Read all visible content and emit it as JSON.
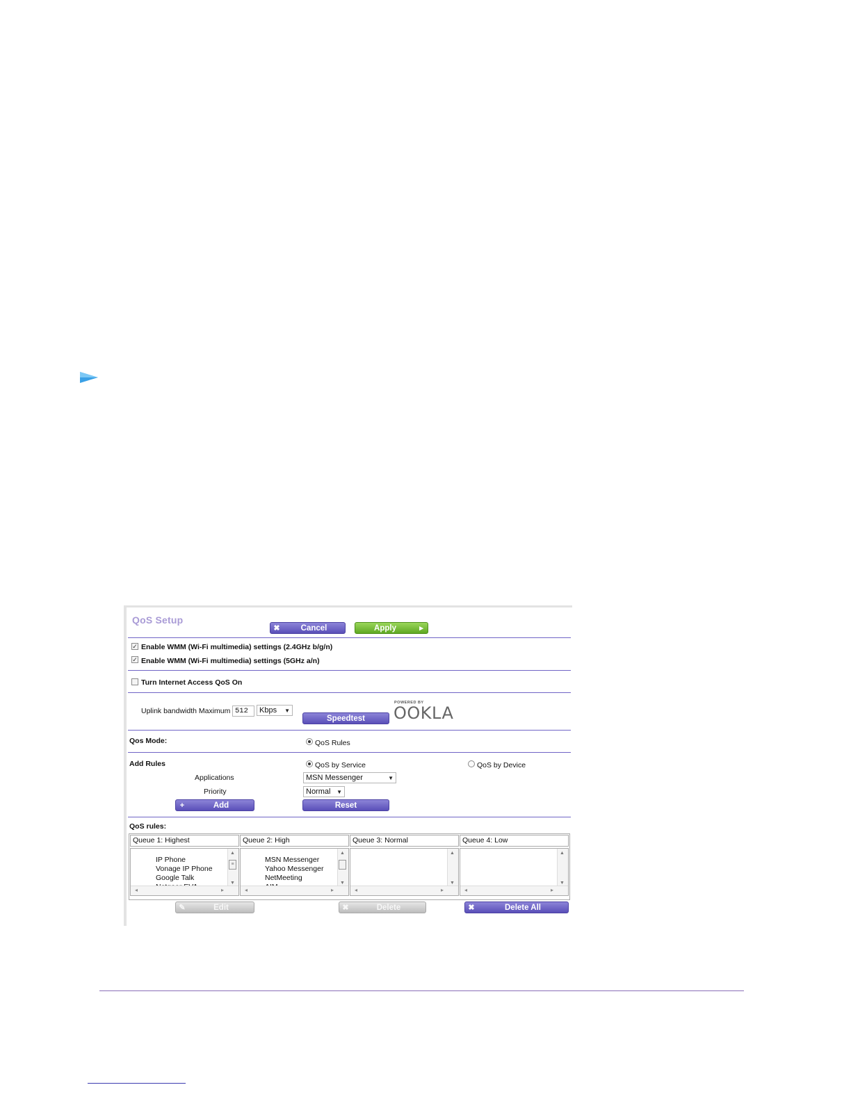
{
  "colors": {
    "accent_purple": "#6f64c6",
    "title_lavender": "#a99bd6",
    "apply_green": "#7cc23e",
    "arrow_blue": "#3aa0e6"
  },
  "qos": {
    "title": "QoS Setup",
    "buttons": {
      "cancel": "Cancel",
      "apply": "Apply"
    },
    "wmm_24": {
      "label": "Enable WMM (Wi-Fi multimedia) settings (2.4GHz b/g/n)",
      "checked": true
    },
    "wmm_5": {
      "label": "Enable WMM (Wi-Fi multimedia) settings (5GHz a/n)",
      "checked": true
    },
    "internet_qos": {
      "label": "Turn Internet Access QoS On",
      "checked": false
    },
    "uplink": {
      "label": "Uplink bandwidth Maximum",
      "value": "512",
      "unit": "Kbps"
    },
    "speedtest": "Speedtest",
    "ookla": {
      "powered_by": "POWERED BY",
      "brand": "OOKLA"
    },
    "mode": {
      "label": "Qos Mode:",
      "option": "QoS Rules"
    },
    "add_rules": {
      "label": "Add Rules",
      "by_service": "QoS by Service",
      "by_device": "QoS by Device",
      "applications_label": "Applications",
      "applications_value": "MSN Messenger",
      "priority_label": "Priority",
      "priority_value": "Normal",
      "add": "Add",
      "reset": "Reset"
    },
    "rules": {
      "label": "QoS rules:",
      "queues": [
        {
          "header": "Queue 1: Highest",
          "items": [
            "IP Phone",
            "Vonage IP Phone",
            "Google Talk",
            "Netgear EVA"
          ]
        },
        {
          "header": "Queue 2: High",
          "items": [
            "MSN Messenger",
            "Yahoo Messenger",
            "NetMeeting",
            "AIM"
          ]
        },
        {
          "header": "Queue 3: Normal",
          "items": []
        },
        {
          "header": "Queue 4: Low",
          "items": []
        }
      ],
      "edit": "Edit",
      "delete": "Delete",
      "delete_all": "Delete All"
    }
  }
}
